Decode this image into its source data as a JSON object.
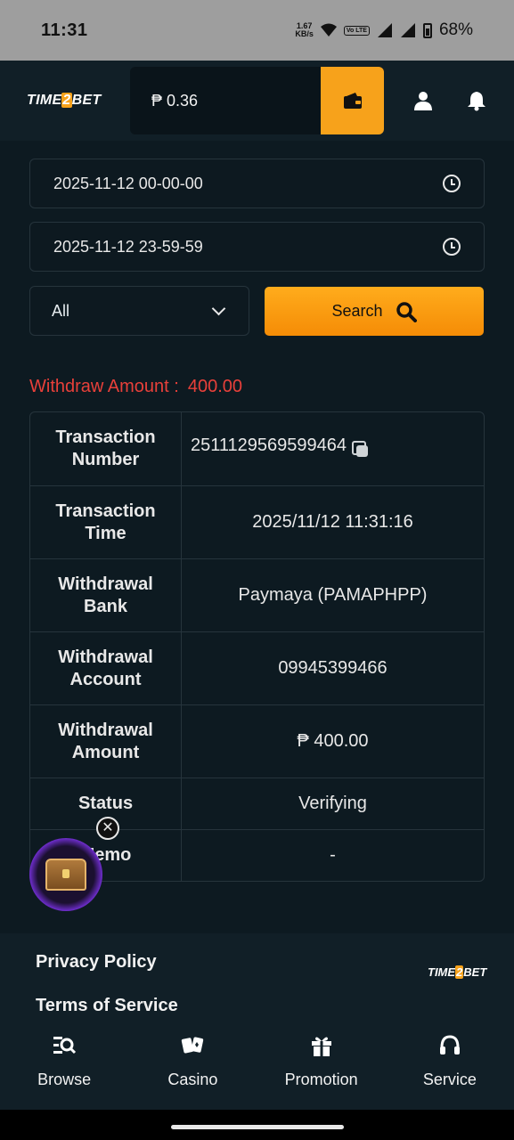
{
  "status_bar": {
    "time": "11:31",
    "speed_value": "1.67",
    "speed_unit": "KB/s",
    "volte": "Vo LTE",
    "battery": "68%"
  },
  "header": {
    "logo": "TIME2BET",
    "balance": "₱ 0.36",
    "icons": [
      "wallet-icon",
      "user-icon",
      "bell-icon"
    ],
    "accent_color": "#f7a21b"
  },
  "filters": {
    "start_time": "2025-11-12 00-00-00",
    "end_time": "2025-11-12 23-59-59",
    "status_selected": "All",
    "search_label": "Search"
  },
  "withdraw_summary": {
    "label": "Withdraw Amount :",
    "value": "400.00",
    "color": "#e8403a"
  },
  "details": {
    "rows": [
      {
        "label": "Transaction Number",
        "value": "2511129569599464"
      },
      {
        "label": "Transaction Time",
        "value": "2025/11/12 11:31:16"
      },
      {
        "label": "Withdrawal Bank",
        "value": "Paymaya (PAMAPHPP)"
      },
      {
        "label": "Withdrawal Account",
        "value": "09945399466"
      },
      {
        "label": "Withdrawal Amount",
        "value": "₱ 400.00"
      },
      {
        "label": "Status",
        "value": "Verifying"
      },
      {
        "label": "Memo",
        "value": "-"
      }
    ]
  },
  "footer": {
    "privacy": "Privacy Policy",
    "terms": "Terms of Service",
    "logo": "TIME2BET"
  },
  "bottom_nav": [
    {
      "label": "Browse",
      "icon": "browse-icon"
    },
    {
      "label": "Casino",
      "icon": "cards-icon"
    },
    {
      "label": "Promotion",
      "icon": "gift-icon"
    },
    {
      "label": "Service",
      "icon": "headset-icon"
    }
  ]
}
